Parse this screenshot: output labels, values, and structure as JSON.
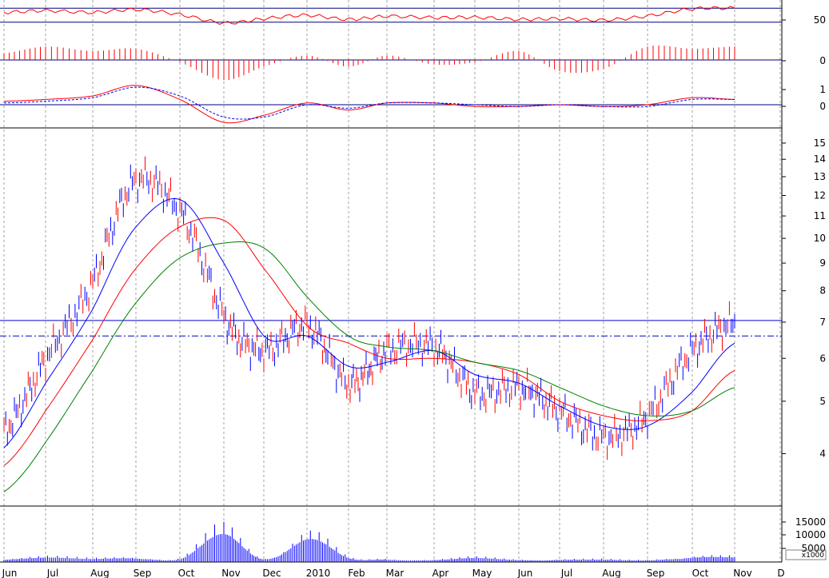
{
  "chart_data": [
    {
      "type": "line",
      "panel": "oscillator",
      "y_ticks": [
        "50"
      ],
      "horizontal_levels": [
        70,
        30
      ],
      "series": [
        {
          "color": "#ff0000",
          "x": [
            "Jun",
            "Jul",
            "Aug",
            "Sep",
            "Oct",
            "Nov",
            "Dec",
            "2010",
            "Feb",
            "Mar",
            "Apr",
            "May",
            "Jun",
            "Jul",
            "Aug",
            "Sep",
            "Oct",
            "Nov"
          ],
          "values": [
            58,
            63,
            58,
            66,
            52,
            28,
            40,
            50,
            38,
            47,
            43,
            44,
            38,
            40,
            36,
            48,
            68,
            70
          ]
        }
      ]
    },
    {
      "type": "bar",
      "panel": "histogram",
      "y_ticks": [
        "0"
      ],
      "x": [
        "Jun",
        "Jul",
        "Aug",
        "Sep",
        "Oct",
        "Nov",
        "Dec",
        "2010",
        "Feb",
        "Mar",
        "Apr",
        "May",
        "Jun",
        "Jul",
        "Aug",
        "Sep",
        "Oct",
        "Nov"
      ],
      "values": [
        0.3,
        0.6,
        0.4,
        0.5,
        -0.1,
        -0.9,
        -0.3,
        0.2,
        -0.3,
        0.2,
        -0.2,
        -0.1,
        0.4,
        -0.5,
        -0.4,
        0.6,
        0.5,
        0.6
      ],
      "color": "#ff0000"
    },
    {
      "type": "line",
      "panel": "macd",
      "y_ticks": [
        "1",
        "0"
      ],
      "series": [
        {
          "color": "#ff0000",
          "x": [
            "Jun",
            "Jul",
            "Aug",
            "Sep",
            "Oct",
            "Nov",
            "Dec",
            "2010",
            "Feb",
            "Mar",
            "Apr",
            "May",
            "Jun",
            "Jul",
            "Aug",
            "Sep",
            "Oct",
            "Nov"
          ],
          "values": [
            0.2,
            0.3,
            0.5,
            1.1,
            0.3,
            -1.0,
            -0.6,
            0.1,
            -0.3,
            0.1,
            0.1,
            -0.1,
            -0.1,
            0.0,
            -0.1,
            0.0,
            0.4,
            0.3
          ]
        },
        {
          "color": "#0000ff",
          "x": [
            "Jun",
            "Jul",
            "Aug",
            "Sep",
            "Oct",
            "Nov",
            "Dec",
            "2010",
            "Feb",
            "Mar",
            "Apr",
            "May",
            "Jun",
            "Jul",
            "Aug",
            "Sep",
            "Oct",
            "Nov"
          ],
          "values": [
            0.1,
            0.2,
            0.4,
            1.0,
            0.5,
            -0.7,
            -0.7,
            0.0,
            -0.2,
            0.1,
            0.1,
            0.0,
            -0.1,
            0.0,
            -0.1,
            -0.1,
            0.3,
            0.3
          ]
        }
      ]
    },
    {
      "type": "line",
      "panel": "price",
      "y_scale": "log",
      "ylim": [
        3.2,
        16
      ],
      "y_ticks": [
        "15",
        "14",
        "13",
        "12",
        "11",
        "10",
        "9",
        "8",
        "7",
        "6",
        "5",
        "4"
      ],
      "horizontal_levels": [
        {
          "value": 7.05,
          "style": "solid"
        },
        {
          "value": 6.6,
          "style": "dash-dot"
        }
      ],
      "x": [
        "Jun",
        "Jul",
        "Aug",
        "Sep",
        "Oct",
        "Nov",
        "Dec",
        "2010",
        "Feb",
        "Mar",
        "Apr",
        "May",
        "Jun",
        "Jul",
        "Aug",
        "Sep",
        "Oct",
        "Nov"
      ],
      "series": [
        {
          "color": "#ff0000",
          "values": [
            4.4,
            6.0,
            8.3,
            12.8,
            11.2,
            7.2,
            6.2,
            6.9,
            5.4,
            6.2,
            6.3,
            5.2,
            5.3,
            4.8,
            4.3,
            4.7,
            6.2,
            7.0
          ]
        },
        {
          "color": "#0000ff",
          "values": [
            4.1,
            5.4,
            7.4,
            10.5,
            11.8,
            9.0,
            6.6,
            6.6,
            5.8,
            5.9,
            6.2,
            5.6,
            5.4,
            4.9,
            4.5,
            4.5,
            5.2,
            6.4
          ]
        },
        {
          "color": "#ff0000",
          "values": [
            3.8,
            4.8,
            6.5,
            8.8,
            10.5,
            10.8,
            8.8,
            6.9,
            6.4,
            6.0,
            6.0,
            5.9,
            5.6,
            5.0,
            4.7,
            4.6,
            4.8,
            5.7
          ]
        },
        {
          "color": "#008000",
          "values": [
            3.4,
            4.2,
            5.7,
            7.6,
            9.2,
            9.8,
            9.6,
            7.8,
            6.6,
            6.3,
            6.2,
            5.9,
            5.7,
            5.3,
            4.9,
            4.7,
            4.8,
            5.3
          ]
        }
      ]
    },
    {
      "type": "bar",
      "panel": "volume",
      "y_ticks": [
        "15000",
        "10000",
        "5000"
      ],
      "unit_label": "x1000",
      "x": [
        "Jun",
        "Jul",
        "Aug",
        "Sep",
        "Oct",
        "Nov",
        "Dec",
        "2010",
        "Feb",
        "Mar",
        "Apr",
        "May",
        "Jun",
        "Jul",
        "Aug",
        "Sep",
        "Oct",
        "Nov"
      ],
      "values": [
        2500,
        3000,
        2000,
        3500,
        2000,
        18000,
        2500,
        17000,
        2500,
        2000,
        1500,
        2500,
        1500,
        1800,
        1500,
        1200,
        4000,
        3000
      ],
      "color": "#0000ff"
    }
  ],
  "x_axis": {
    "labels": [
      "Jun",
      "Jul",
      "Aug",
      "Sep",
      "Oct",
      "Nov",
      "Dec",
      "2010",
      "Feb",
      "Mar",
      "Apr",
      "May",
      "Jun",
      "Jul",
      "Aug",
      "Sep",
      "Oct",
      "Nov",
      "D"
    ]
  },
  "colors": {
    "up_bar": "#0000ff",
    "down_bar": "#ff0000",
    "grid": "#a0a0a0",
    "background": "#ffffff"
  }
}
